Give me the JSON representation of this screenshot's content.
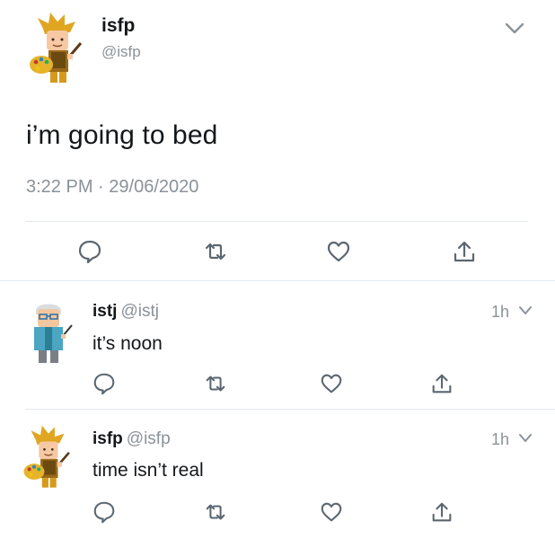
{
  "main_tweet": {
    "display_name": "isfp",
    "handle": "@isfp",
    "text": "i’m going to bed",
    "time": "3:22 PM",
    "separator": "·",
    "date": "29/06/2020",
    "avatar_icon": "isfp-painter-avatar",
    "actions": [
      "reply-icon",
      "retweet-icon",
      "like-icon",
      "share-icon"
    ]
  },
  "replies": [
    {
      "display_name": "istj",
      "handle": "@istj",
      "text": "it’s noon",
      "time": "1h",
      "avatar_icon": "istj-scientist-avatar"
    },
    {
      "display_name": "isfp",
      "handle": "@isfp",
      "text": "time isn’t real",
      "time": "1h",
      "avatar_icon": "isfp-painter-avatar"
    }
  ],
  "colors": {
    "text": "#14171a",
    "muted": "#8a9299",
    "divider": "#e1e8ed",
    "icon": "#5b6670",
    "avatar_gold": "#d9a520"
  }
}
